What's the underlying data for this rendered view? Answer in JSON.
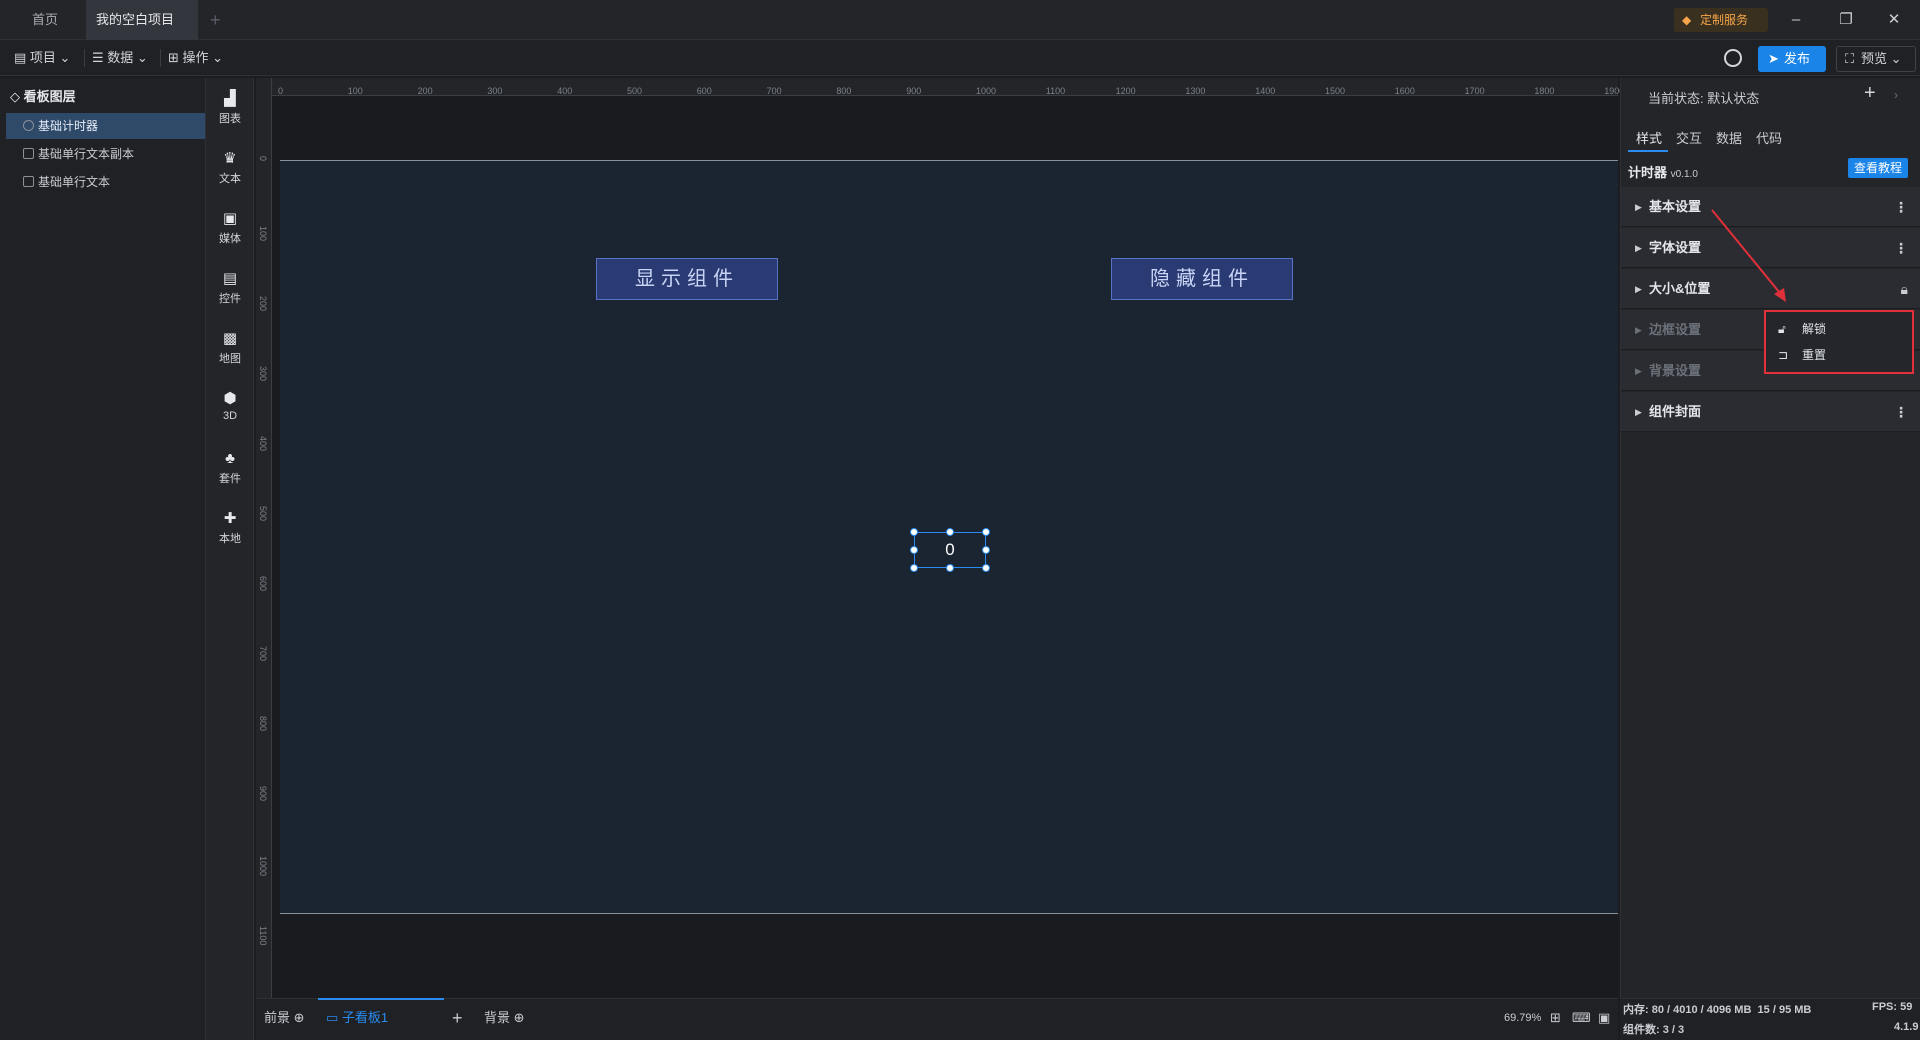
{
  "titlebar": {
    "tabs": [
      {
        "label": "首页"
      },
      {
        "label": "我的空白项目"
      }
    ],
    "custom_service": "定制服务"
  },
  "toolbar": {
    "menus": [
      {
        "label": "项目"
      },
      {
        "label": "数据"
      },
      {
        "label": "操作"
      }
    ],
    "publish": "发布",
    "preview": "预览"
  },
  "layers": {
    "title": "看板图层",
    "items": [
      {
        "label": "基础计时器"
      },
      {
        "label": "基础单行文本副本"
      },
      {
        "label": "基础单行文本"
      }
    ]
  },
  "components": [
    {
      "label": "图表",
      "icon": "chart-icon"
    },
    {
      "label": "文本",
      "icon": "text-icon"
    },
    {
      "label": "媒体",
      "icon": "media-icon"
    },
    {
      "label": "控件",
      "icon": "control-icon"
    },
    {
      "label": "地图",
      "icon": "map-icon"
    },
    {
      "label": "3D",
      "icon": "cube-icon"
    },
    {
      "label": "套件",
      "icon": "shirt-icon"
    },
    {
      "label": "本地",
      "icon": "puzzle-icon"
    }
  ],
  "ruler": {
    "top": [
      "0",
      "100",
      "200",
      "300",
      "400",
      "500",
      "600",
      "700",
      "800",
      "900",
      "1000",
      "1100",
      "1200",
      "1300",
      "1400",
      "1500",
      "1600",
      "1700",
      "1800",
      "1900"
    ],
    "left": [
      "0",
      "100",
      "200",
      "300",
      "400",
      "500",
      "600",
      "700",
      "800",
      "900",
      "1000",
      "1100"
    ]
  },
  "canvas": {
    "show_button": "显示组件",
    "hide_button": "隐藏组件",
    "counter_value": "0"
  },
  "bottom": {
    "tabs": [
      {
        "label": "前景"
      },
      {
        "label": "子看板1"
      },
      {
        "label": "背景"
      }
    ],
    "zoom": "69.79%"
  },
  "right_panel": {
    "state_label": "当前状态:",
    "state_value": "默认状态",
    "tabs": [
      {
        "label": "样式"
      },
      {
        "label": "交互"
      },
      {
        "label": "数据"
      },
      {
        "label": "代码"
      }
    ],
    "component_name": "计时器",
    "component_version": "v0.1.0",
    "tutorial": "查看教程",
    "sections": [
      {
        "label": "基本设置"
      },
      {
        "label": "字体设置"
      },
      {
        "label": "大小&位置"
      },
      {
        "label": "边框设置"
      },
      {
        "label": "背景设置"
      },
      {
        "label": "组件封面"
      }
    ],
    "context_menu": [
      {
        "label": "解锁",
        "icon": "unlock-icon"
      },
      {
        "label": "重置",
        "icon": "reset-icon"
      }
    ]
  },
  "status": {
    "memory_label": "内存:",
    "memory_value": "80 / 4010 / 4096 MB",
    "memory_value2": "15 / 95 MB",
    "fps_label": "FPS:",
    "fps_value": "59",
    "component_count_label": "组件数:",
    "component_count_value": "3 / 3",
    "version": "4.1.9"
  },
  "colors": {
    "accent": "#1a84e8",
    "highlight_red": "#e0303a",
    "canvas_bg": "#1b2431",
    "button_bg": "#2a3a72"
  }
}
